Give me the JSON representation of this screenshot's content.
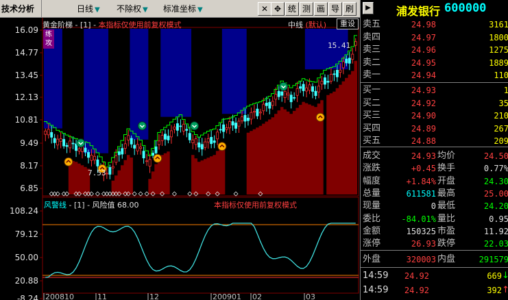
{
  "toolbar": {
    "panel_title": "技术分析",
    "period": "日线",
    "adjust": "不除权",
    "coord": "标准坐标",
    "btn_move": "✥",
    "btn_stat": "统",
    "btn_measure": "测",
    "btn_draw": "画",
    "btn_guide": "导",
    "btn_refresh": "刷",
    "btn_toggle": "▶"
  },
  "stock": {
    "name": "浦发银行",
    "code": "600000"
  },
  "main_panel": {
    "indicator_name": "黄金阶梯",
    "params": "[1]",
    "notice": "本指标仅使用前复权模式",
    "line_label": "中线",
    "line_mode": "(默认)",
    "reset_btn": "重设",
    "side_tag": "练 攻",
    "high_label": "15.41",
    "low_label": "7.53",
    "y_ticks": [
      "16.09",
      "14.77",
      "13.45",
      "12.13",
      "10.81",
      "9.49",
      "8.17",
      "6.85"
    ]
  },
  "sub_panel": {
    "indicator_name": "风警线",
    "params": "[1]",
    "value_label": "风险值",
    "value": "68.00",
    "notice": "本指标仅使用前复权模式",
    "y_ticks": [
      "108.24",
      "79.12",
      "50.00",
      "20.88",
      "-8.24"
    ]
  },
  "x_axis": {
    "labels": [
      "200810",
      "11",
      "12",
      "200901",
      "02",
      "03"
    ]
  },
  "colors": {
    "up": "#ff3030",
    "down": "#40ffff",
    "band_blue": "#00008b",
    "band_red": "#800000",
    "ladder_green": "#00ff00",
    "risk_line": "#40e0e0",
    "grid": "#800000"
  },
  "quotes": {
    "asks": [
      {
        "label": "卖五",
        "price": "24.98",
        "vol": "3161"
      },
      {
        "label": "卖四",
        "price": "24.97",
        "vol": "1800"
      },
      {
        "label": "卖三",
        "price": "24.96",
        "vol": "1275"
      },
      {
        "label": "卖二",
        "price": "24.95",
        "vol": "1889"
      },
      {
        "label": "卖一",
        "price": "24.94",
        "vol": "110"
      }
    ],
    "bids": [
      {
        "label": "买一",
        "price": "24.93",
        "vol": "1"
      },
      {
        "label": "买二",
        "price": "24.92",
        "vol": "35"
      },
      {
        "label": "买三",
        "price": "24.90",
        "vol": "210"
      },
      {
        "label": "买四",
        "price": "24.89",
        "vol": "267"
      },
      {
        "label": "买五",
        "price": "24.88",
        "vol": "209"
      }
    ],
    "stats": [
      {
        "l1": "成交",
        "v1": "24.93",
        "c1": "red",
        "l2": "均价",
        "v2": "24.50",
        "c2": "red"
      },
      {
        "l1": "涨跌",
        "v1": "+0.45",
        "c1": "red",
        "l2": "换手",
        "v2": "0.77%",
        "c2": "white"
      },
      {
        "l1": "幅度",
        "v1": "+1.84%",
        "c1": "red",
        "l2": "开盘",
        "v2": "24.30",
        "c2": "green"
      },
      {
        "l1": "总量",
        "v1": "611581",
        "c1": "cyan",
        "l2": "最高",
        "v2": "25.00",
        "c2": "red"
      },
      {
        "l1": "现量",
        "v1": "0",
        "c1": "white",
        "l2": "最低",
        "v2": "24.20",
        "c2": "green"
      },
      {
        "l1": "委比",
        "v1": "-84.01%",
        "c1": "green",
        "l2": "量比",
        "v2": "0.95",
        "c2": "white"
      },
      {
        "l1": "金额",
        "v1": "150325",
        "c1": "white",
        "l2": "市盈",
        "v2": "11.92",
        "c2": "white"
      },
      {
        "l1": "涨停",
        "v1": "26.93",
        "c1": "red",
        "l2": "跌停",
        "v2": "22.03",
        "c2": "green"
      }
    ],
    "outer_label": "外盘",
    "outer_value": "320003",
    "inner_label": "内盘",
    "inner_value": "291579",
    "ticks": [
      {
        "time": "14:59",
        "price": "24.92",
        "vol": "669",
        "dir": "↓"
      },
      {
        "time": "14:59",
        "price": "24.92",
        "vol": "392",
        "dir": "↑"
      }
    ]
  }
}
